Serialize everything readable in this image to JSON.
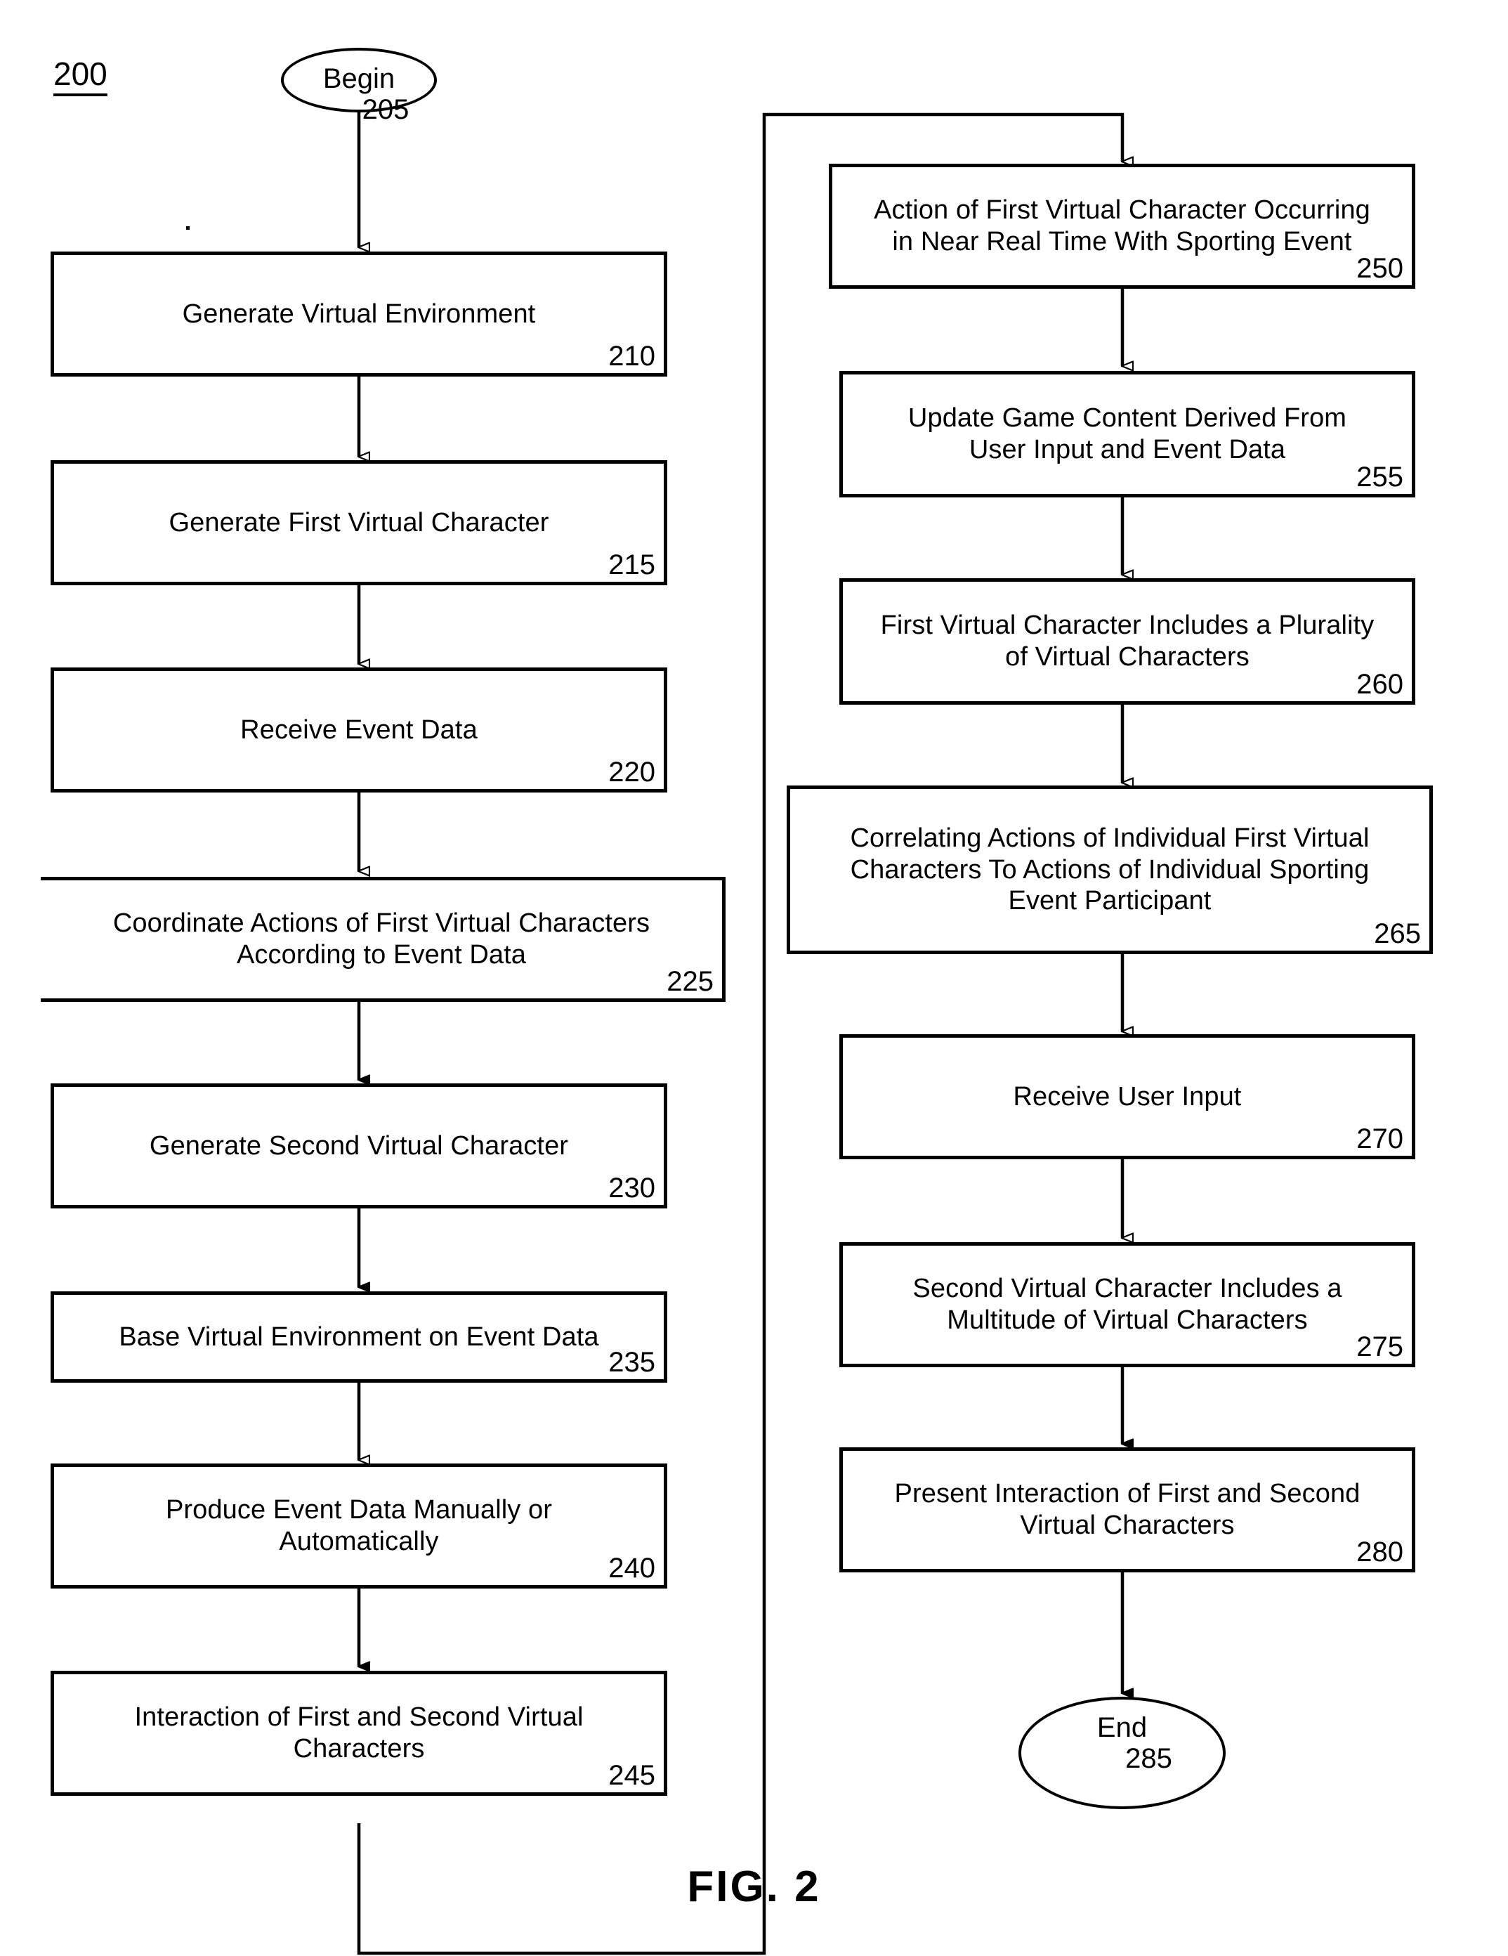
{
  "figure": {
    "number": "200",
    "caption": "FIG. 2"
  },
  "terminals": [
    {
      "id": "begin",
      "label": "Begin",
      "ref": "205"
    },
    {
      "id": "end",
      "label": "End",
      "ref": "285"
    }
  ],
  "left_column": [
    {
      "id": "step-210",
      "label": "Generate Virtual Environment",
      "ref": "210"
    },
    {
      "id": "step-215",
      "label": "Generate First Virtual Character",
      "ref": "215"
    },
    {
      "id": "step-220",
      "label": "Receive Event Data",
      "ref": "220"
    },
    {
      "id": "step-225",
      "label": "Coordinate Actions of First Virtual Characters\nAccording to Event Data",
      "ref": "225"
    },
    {
      "id": "step-230",
      "label": "Generate Second Virtual Character",
      "ref": "230"
    },
    {
      "id": "step-235",
      "label": "Base Virtual Environment on Event Data",
      "ref": "235"
    },
    {
      "id": "step-240",
      "label": "Produce Event Data Manually or\nAutomatically",
      "ref": "240"
    },
    {
      "id": "step-245",
      "label": "Interaction of First and Second Virtual\nCharacters",
      "ref": "245"
    }
  ],
  "right_column": [
    {
      "id": "step-250",
      "label": "Action of First Virtual Character Occurring\nin Near Real Time With Sporting Event",
      "ref": "250"
    },
    {
      "id": "step-255",
      "label": "Update Game Content Derived From\nUser Input and Event Data",
      "ref": "255"
    },
    {
      "id": "step-260",
      "label": "First Virtual Character Includes a Plurality\nof Virtual Characters",
      "ref": "260"
    },
    {
      "id": "step-265",
      "label": "Correlating Actions of Individual First Virtual\nCharacters To Actions of Individual Sporting\nEvent Participant",
      "ref": "265"
    },
    {
      "id": "step-270",
      "label": "Receive User Input",
      "ref": "270"
    },
    {
      "id": "step-275",
      "label": "Second Virtual Character Includes a\nMultitude of Virtual Characters",
      "ref": "275"
    },
    {
      "id": "step-280",
      "label": "Present Interaction of First and Second\nVirtual Characters",
      "ref": "280"
    }
  ],
  "style": {
    "ink": "#000000",
    "paper": "#ffffff"
  }
}
